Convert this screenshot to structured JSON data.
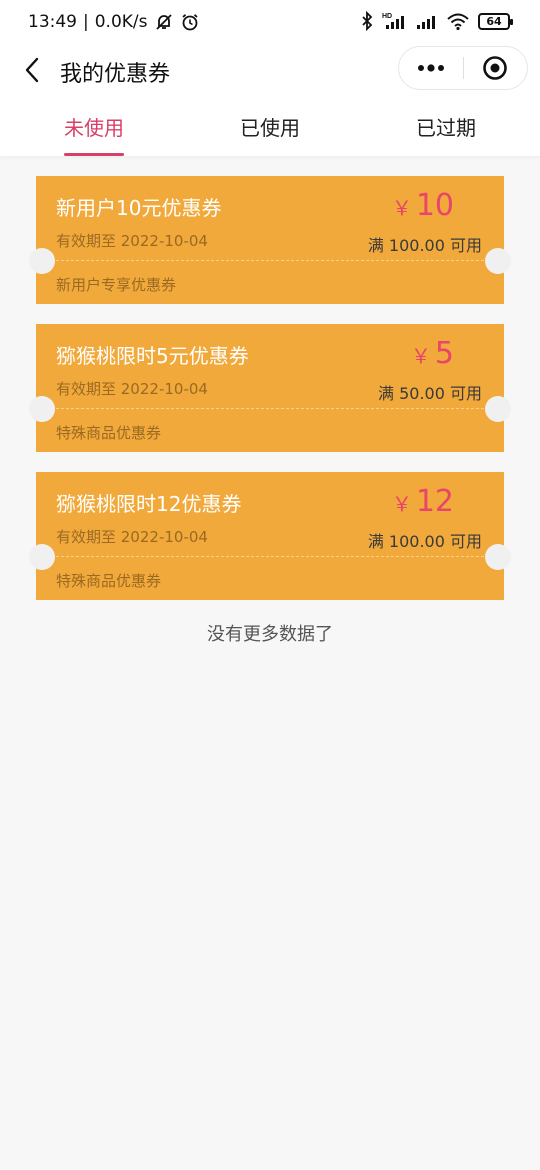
{
  "status_bar": {
    "time": "13:49",
    "network_speed": "0.0K/s",
    "battery": "64"
  },
  "nav": {
    "title": "我的优惠券"
  },
  "tabs": [
    {
      "label": "未使用",
      "active": true
    },
    {
      "label": "已使用",
      "active": false
    },
    {
      "label": "已过期",
      "active": false
    }
  ],
  "coupons": [
    {
      "title": "新用户10元优惠券",
      "valid": "有效期至 2022-10-04",
      "currency": "￥",
      "amount": "10",
      "condition": "满 100.00 可用",
      "type": "新用户专享优惠券"
    },
    {
      "title": "猕猴桃限时5元优惠券",
      "valid": "有效期至 2022-10-04",
      "currency": "￥",
      "amount": "5",
      "condition": "满 50.00 可用",
      "type": "特殊商品优惠券"
    },
    {
      "title": "猕猴桃限时12优惠券",
      "valid": "有效期至 2022-10-04",
      "currency": "￥",
      "amount": "12",
      "condition": "满 100.00 可用",
      "type": "特殊商品优惠券"
    }
  ],
  "footer": {
    "no_more": "没有更多数据了"
  },
  "colors": {
    "accent": "#d8406a",
    "coupon_bg": "#f2a93b",
    "amount": "#e8456a"
  },
  "icons": {
    "back": "chevron-left-icon",
    "more": "more-dots-icon",
    "close": "target-close-icon"
  }
}
